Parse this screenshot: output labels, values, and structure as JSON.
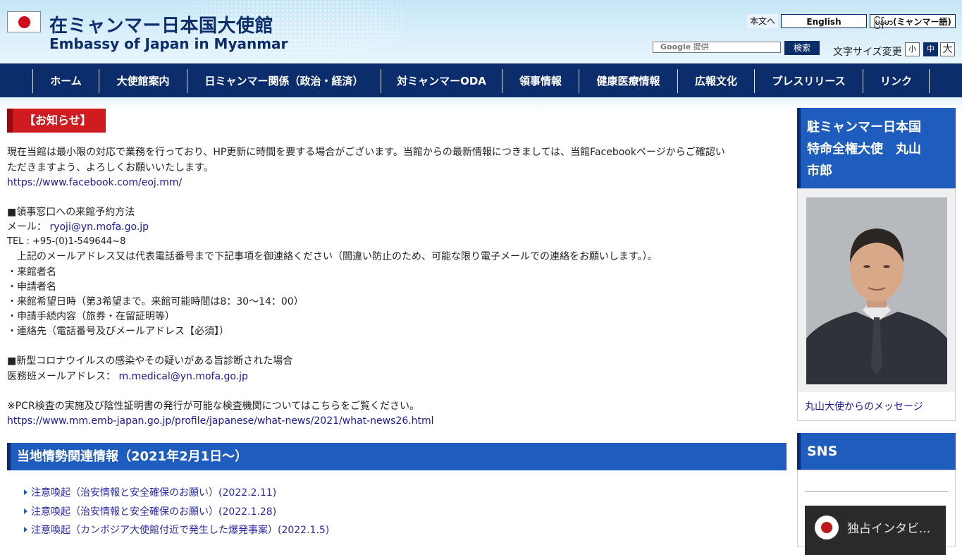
{
  "header": {
    "title_jp": "在ミャンマー日本国大使館",
    "title_en": "Embassy of Japan in Myanmar",
    "skip_link": "本文へ",
    "lang_english": "English",
    "lang_myanmar": "မြန်မာ(ミャンマー語)",
    "search_google": "Google",
    "search_provided": "提供",
    "search_button": "検索",
    "font_size_label": "文字サイズ変更",
    "font_small": "小",
    "font_medium": "中",
    "font_large": "大"
  },
  "nav": {
    "items": [
      {
        "label": "ホーム"
      },
      {
        "label": "大使館案内"
      },
      {
        "label": "日ミャンマー関係（政治・経済）"
      },
      {
        "label": "対ミャンマーODA"
      },
      {
        "label": "領事情報"
      },
      {
        "label": "健康医療情報"
      },
      {
        "label": "広報文化"
      },
      {
        "label": "プレスリリース"
      },
      {
        "label": "リンク"
      }
    ]
  },
  "main": {
    "notice_tag": "【お知らせ】",
    "intro_line1": "現在当館は最小限の対応で業務を行っており、HP更新に時間を要する場合がございます。当館からの最新情報につきましては、当館Facebookページからご確認い",
    "intro_line2": "ただきますよう、よろしくお願いいたします。",
    "facebook_url": "https://www.facebook.com/eoj.mm/",
    "consular_heading": "■領事窓口への来館予約方法",
    "mail_label": "メール：",
    "mail_address": "ryoji@yn.mofa.go.jp",
    "tel": "TEL : +95-(0)1-549644~8",
    "contact_instruction": "　上記のメールアドレス又は代表電話番号まで下記事項を御連絡ください（間違い防止のため、可能な限り電子メールでの連絡をお願いします。）。",
    "bullet_visitor": "・来館者名",
    "bullet_applicant": "・申請者名",
    "bullet_date": "・来館希望日時（第3希望まで。来館可能時間は8：30～14：00）",
    "bullet_procedure": "・申請手続内容（旅券・在留証明等）",
    "bullet_contact": "・連絡先（電話番号及びメールアドレス【必須】）",
    "covid_heading": "■新型コロナウイルスの感染やその疑いがある旨診断された場合",
    "medical_label": "医務班メールアドレス：",
    "medical_mail": "m.medical@yn.mofa.go.jp",
    "pcr_note": "※PCR検査の実施及び陰性証明書の発行が可能な検査機関についてはこちらをご覧ください。",
    "pcr_url": "https://www.mm.emb-japan.go.jp/profile/japanese/what-news/2021/what-news26.html",
    "section_title": "当地情勢関連情報（2021年2月1日～）",
    "news": [
      {
        "label": "注意喚起（治安情報と安全確保のお願い）(2022.2.11)"
      },
      {
        "label": "注意喚起（治安情報と安全確保のお願い）(2022.1.28)"
      },
      {
        "label": "注意喚起（カンボジア大使館付近で発生した爆発事案）(2022.1.5)"
      }
    ]
  },
  "sidebar": {
    "ambassador_line1": "駐ミャンマー日本国",
    "ambassador_line2": "特命全権大使　丸山",
    "ambassador_line3": "市郎",
    "message_link": "丸山大使からのメッセージ",
    "sns_title": "SNS",
    "video_title": "独占インタビ..."
  },
  "colors": {
    "navy": "#0c2d6b",
    "section_blue": "#1e5dbd",
    "notice_red": "#d01b20",
    "flag_red": "#d20b1c"
  },
  "icons": [
    "japan-flag-icon",
    "play-channel-icon",
    "triangle-bullet-icon"
  ]
}
